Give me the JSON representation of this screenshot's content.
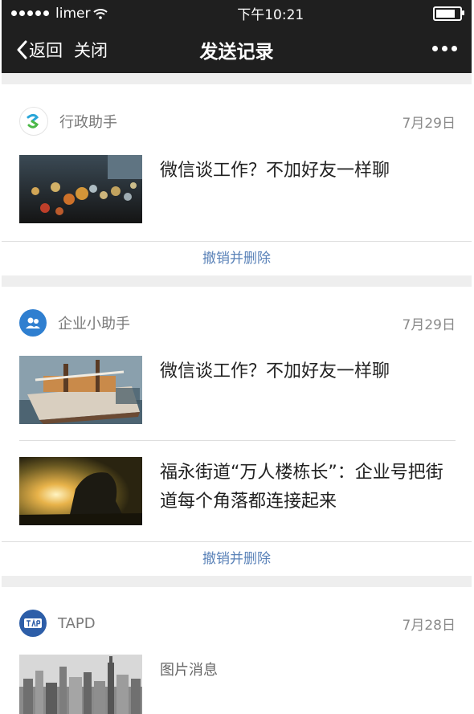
{
  "status_bar": {
    "carrier": "limer",
    "time": "下午10:21",
    "battery_level": 0.95
  },
  "nav": {
    "back_label": "返回",
    "close_label": "关闭",
    "title": "发送记录"
  },
  "records": [
    {
      "source": "行政助手",
      "date": "7月29日",
      "items": [
        {
          "title": "微信谈工作？不加好友一样聊",
          "thumb": "bokeh-lights"
        }
      ],
      "action": "撤销并删除"
    },
    {
      "source": "企业小助手",
      "date": "7月29日",
      "items": [
        {
          "title": "微信谈工作？不加好友一样聊",
          "thumb": "boat"
        },
        {
          "title": "福永街道“万人楼栋长”：企业号把街道每个角落都连接起来",
          "thumb": "sunset-hand"
        }
      ],
      "action": "撤销并删除"
    },
    {
      "source": "TAPD",
      "date": "7月28日",
      "items": [
        {
          "title": "图片消息",
          "thumb": "city-skyline"
        }
      ]
    }
  ],
  "colors": {
    "nav_bg": "#1f1f1f",
    "action_text": "#5a82b8",
    "page_bg": "#eeeeee"
  }
}
